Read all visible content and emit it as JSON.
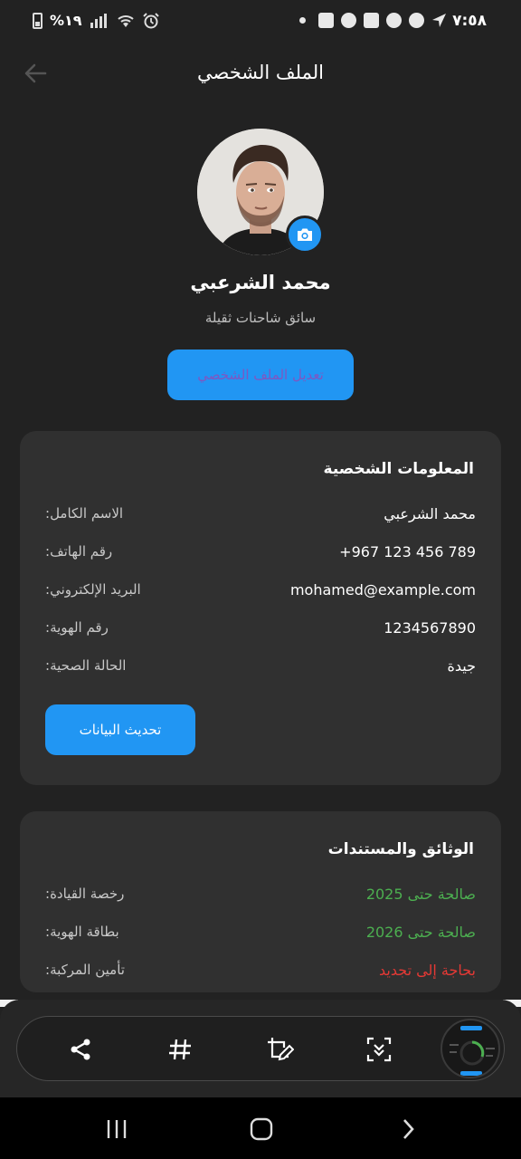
{
  "status_bar": {
    "time": "٧:٥٨",
    "battery_text": "%١٩"
  },
  "header": {
    "title": "الملف الشخصي"
  },
  "profile": {
    "name": "محمد الشرعبي",
    "role": "سائق شاحنات ثقيلة",
    "edit_button": "تعديل الملف الشخصي"
  },
  "personal_info": {
    "title": "المعلومات الشخصية",
    "rows": [
      {
        "label": ":الاسم الكامل",
        "value": "محمد الشرعبي"
      },
      {
        "label": ":رقم الهاتف",
        "value": "+967 123 456 789"
      },
      {
        "label": ":البريد الإلكتروني",
        "value": "mohamed@example.com"
      },
      {
        "label": ":رقم الهوية",
        "value": "1234567890"
      },
      {
        "label": ":الحالة الصحية",
        "value": "جيدة"
      }
    ],
    "update_button": "تحديث البيانات"
  },
  "documents": {
    "title": "الوثائق والمستندات",
    "rows": [
      {
        "label": ":رخصة القيادة",
        "value": "صالحة حتى 2025",
        "status": "valid"
      },
      {
        "label": ":بطاقة الهوية",
        "value": "صالحة حتى 2026",
        "status": "valid"
      },
      {
        "label": ":تأمين المركبة",
        "value": "بحاجة إلى تجديد",
        "status": "renew"
      }
    ]
  },
  "toolbar": {
    "icons": [
      "share-icon",
      "hashtag-icon",
      "crop-edit-icon",
      "scroll-capture-icon"
    ]
  },
  "navbar": {
    "icons": [
      "recent-apps-icon",
      "home-icon",
      "back-icon"
    ]
  },
  "colors": {
    "background": "#222222",
    "card": "#303030",
    "accent": "#2196f3",
    "valid": "#4caf50",
    "warning": "#e53935"
  }
}
